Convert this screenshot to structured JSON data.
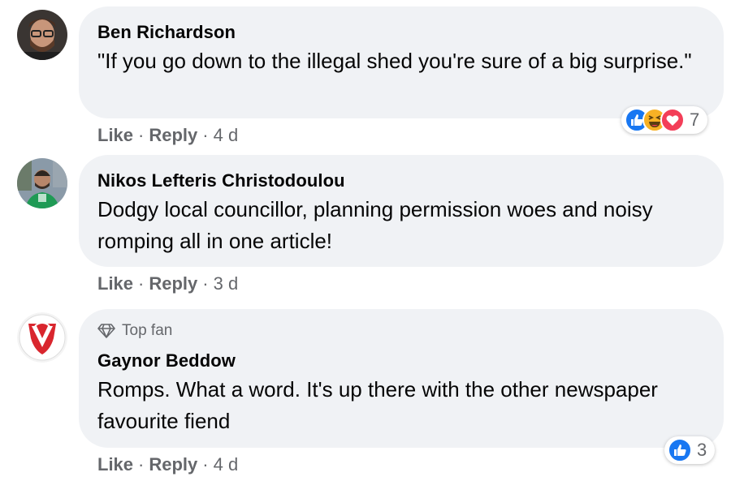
{
  "comments": [
    {
      "author": "Ben Richardson",
      "text": "\"If you go down to the illegal shed you're sure of a big surprise.\"",
      "actions": {
        "like": "Like",
        "reply": "Reply",
        "time": "4 d",
        "separator": "·"
      },
      "reactions": {
        "types": [
          "like-icon",
          "laugh-icon",
          "love-icon"
        ],
        "count": "7"
      },
      "badge": null
    },
    {
      "author": "Nikos Lefteris Christodoulou",
      "text": "Dodgy local councillor, planning permission woes and noisy romping all in one article!",
      "actions": {
        "like": "Like",
        "reply": "Reply",
        "time": "3 d",
        "separator": "·"
      },
      "reactions": null,
      "badge": null
    },
    {
      "author": "Gaynor Beddow",
      "text": "Romps. What a word. It's up there with the other newspaper favourite fiend",
      "actions": {
        "like": "Like",
        "reply": "Reply",
        "time": "4 d",
        "separator": "·"
      },
      "reactions": {
        "types": [
          "like-icon"
        ],
        "count": "3"
      },
      "badge": {
        "icon": "diamond-icon",
        "label": "Top fan"
      }
    }
  ],
  "colors": {
    "bubble": "#f0f2f5",
    "meta_text": "#65676b",
    "like_blue": "#1877f2",
    "love_red": "#f33e58",
    "haha_yellow": "#f7b125"
  }
}
